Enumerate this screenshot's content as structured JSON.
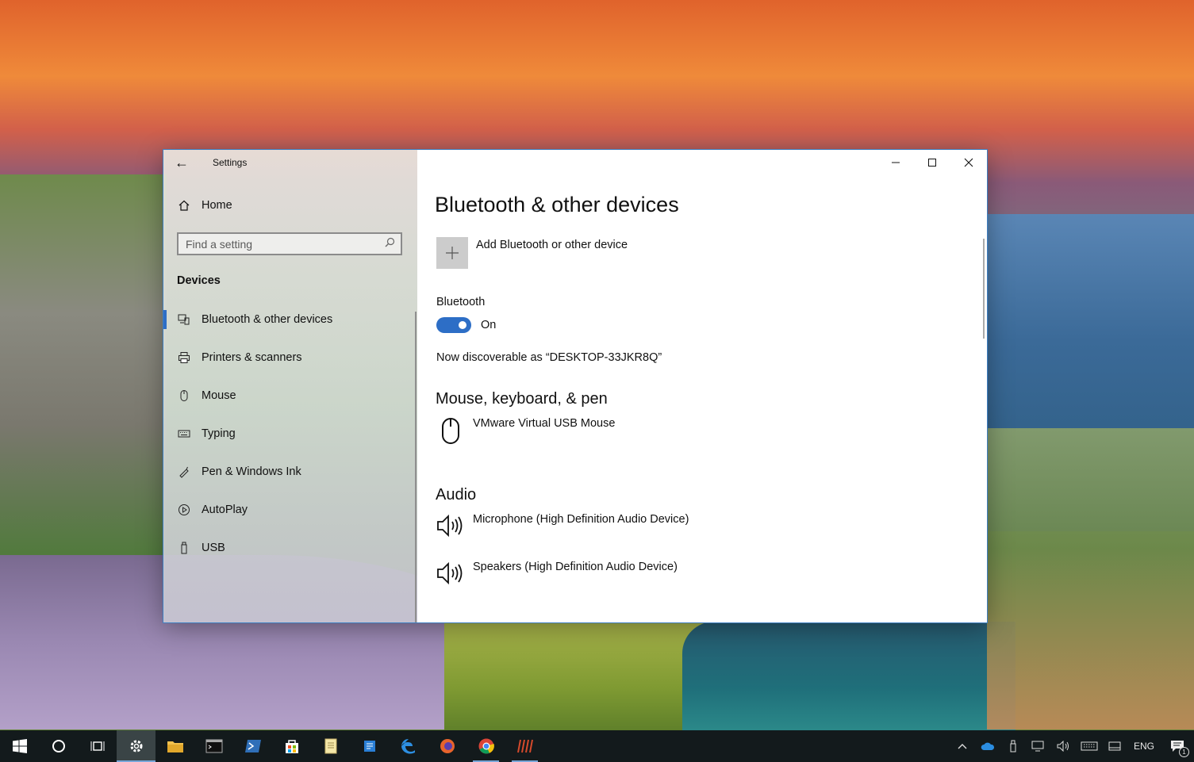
{
  "window": {
    "app_title": "Settings",
    "back_label": "←"
  },
  "sidebar": {
    "home_label": "Home",
    "search_placeholder": "Find a setting",
    "section_title": "Devices",
    "items": [
      {
        "label": "Bluetooth & other devices",
        "icon": "bluetooth-devices-icon",
        "active": true
      },
      {
        "label": "Printers & scanners",
        "icon": "printer-icon",
        "active": false
      },
      {
        "label": "Mouse",
        "icon": "mouse-icon",
        "active": false
      },
      {
        "label": "Typing",
        "icon": "keyboard-icon",
        "active": false
      },
      {
        "label": "Pen & Windows Ink",
        "icon": "pen-icon",
        "active": false
      },
      {
        "label": "AutoPlay",
        "icon": "autoplay-icon",
        "active": false
      },
      {
        "label": "USB",
        "icon": "usb-icon",
        "active": false
      }
    ]
  },
  "main": {
    "title": "Bluetooth & other devices",
    "add_device_label": "Add Bluetooth or other device",
    "bluetooth_label": "Bluetooth",
    "bluetooth_state": "On",
    "bluetooth_on": true,
    "discoverable_text": "Now discoverable as “DESKTOP-33JKR8Q”",
    "sections": [
      {
        "heading": "Mouse, keyboard, & pen",
        "devices": [
          {
            "name": "VMware Virtual USB Mouse",
            "icon": "mouse-icon"
          }
        ]
      },
      {
        "heading": "Audio",
        "devices": [
          {
            "name": "Microphone (High Definition Audio Device)",
            "icon": "speaker-icon"
          },
          {
            "name": "Speakers (High Definition Audio Device)",
            "icon": "speaker-icon"
          }
        ]
      }
    ]
  },
  "taskbar": {
    "apps": [
      "start-icon",
      "cortana-icon",
      "task-view-icon",
      "settings-icon",
      "file-explorer-icon",
      "command-prompt-icon",
      "powershell-icon",
      "store-icon",
      "notepad-icon",
      "app-icon",
      "edge-icon",
      "firefox-icon",
      "chrome-icon",
      "app-icon"
    ],
    "language": "ENG",
    "notification_count": "1"
  },
  "colors": {
    "accent": "#2d6ec6",
    "taskbar": "#131a1c",
    "window_border": "#3f7fc1"
  }
}
